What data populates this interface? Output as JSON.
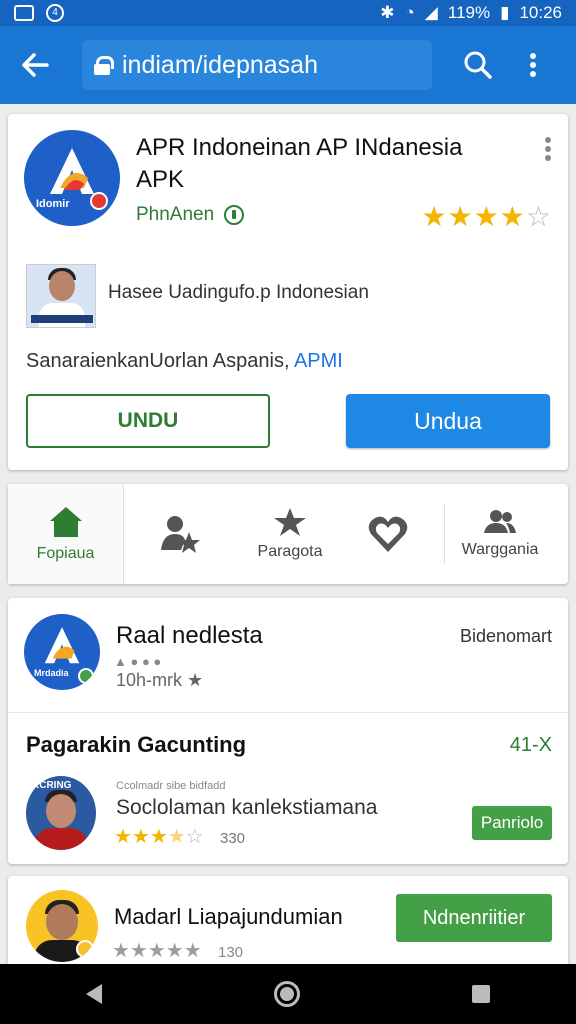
{
  "status_bar": {
    "battery": "119%",
    "time": "10:26"
  },
  "browser": {
    "url": "indiam/idepnasah"
  },
  "app": {
    "title": "APR Indoneinan AP INdanesia APK",
    "developer": "PhnAnen",
    "logo_text": "Idomir",
    "rating": 4,
    "promo_text": "Hasee Uadingufo.p Indonesian",
    "description": "SanaraienkanUorlan Aspanis,",
    "description_link": "APMI",
    "install_outline_label": "UNDU",
    "install_primary_label": "Undua"
  },
  "nav": {
    "items": [
      {
        "label": "Fopiaua",
        "active": true
      },
      {
        "label": ""
      },
      {
        "label": "Paragota"
      },
      {
        "label": ""
      },
      {
        "label": "Warggania"
      }
    ]
  },
  "list": {
    "item1": {
      "title": "Raal nedlesta",
      "subtitle": "10h-mrk",
      "right_text": "Bidenomart",
      "logo_text": "Mrdadia"
    },
    "section_title": "Pagarakin Gacunting",
    "section_count": "41-X",
    "item2": {
      "small": "Ccolmadr sibe bidfadd",
      "title": "Soclolaman kanlekstiamana",
      "rating": 3.5,
      "count": "330",
      "button": "Panriolo",
      "avatar_caption": "RCRING"
    },
    "item3": {
      "title": "Madarl Liapajundumian",
      "count": "130",
      "button": "Ndnenriitier"
    }
  },
  "colors": {
    "primary": "#1976d2",
    "accent_green": "#2e7d32",
    "button_green": "#43a047",
    "star": "#f4b400"
  }
}
